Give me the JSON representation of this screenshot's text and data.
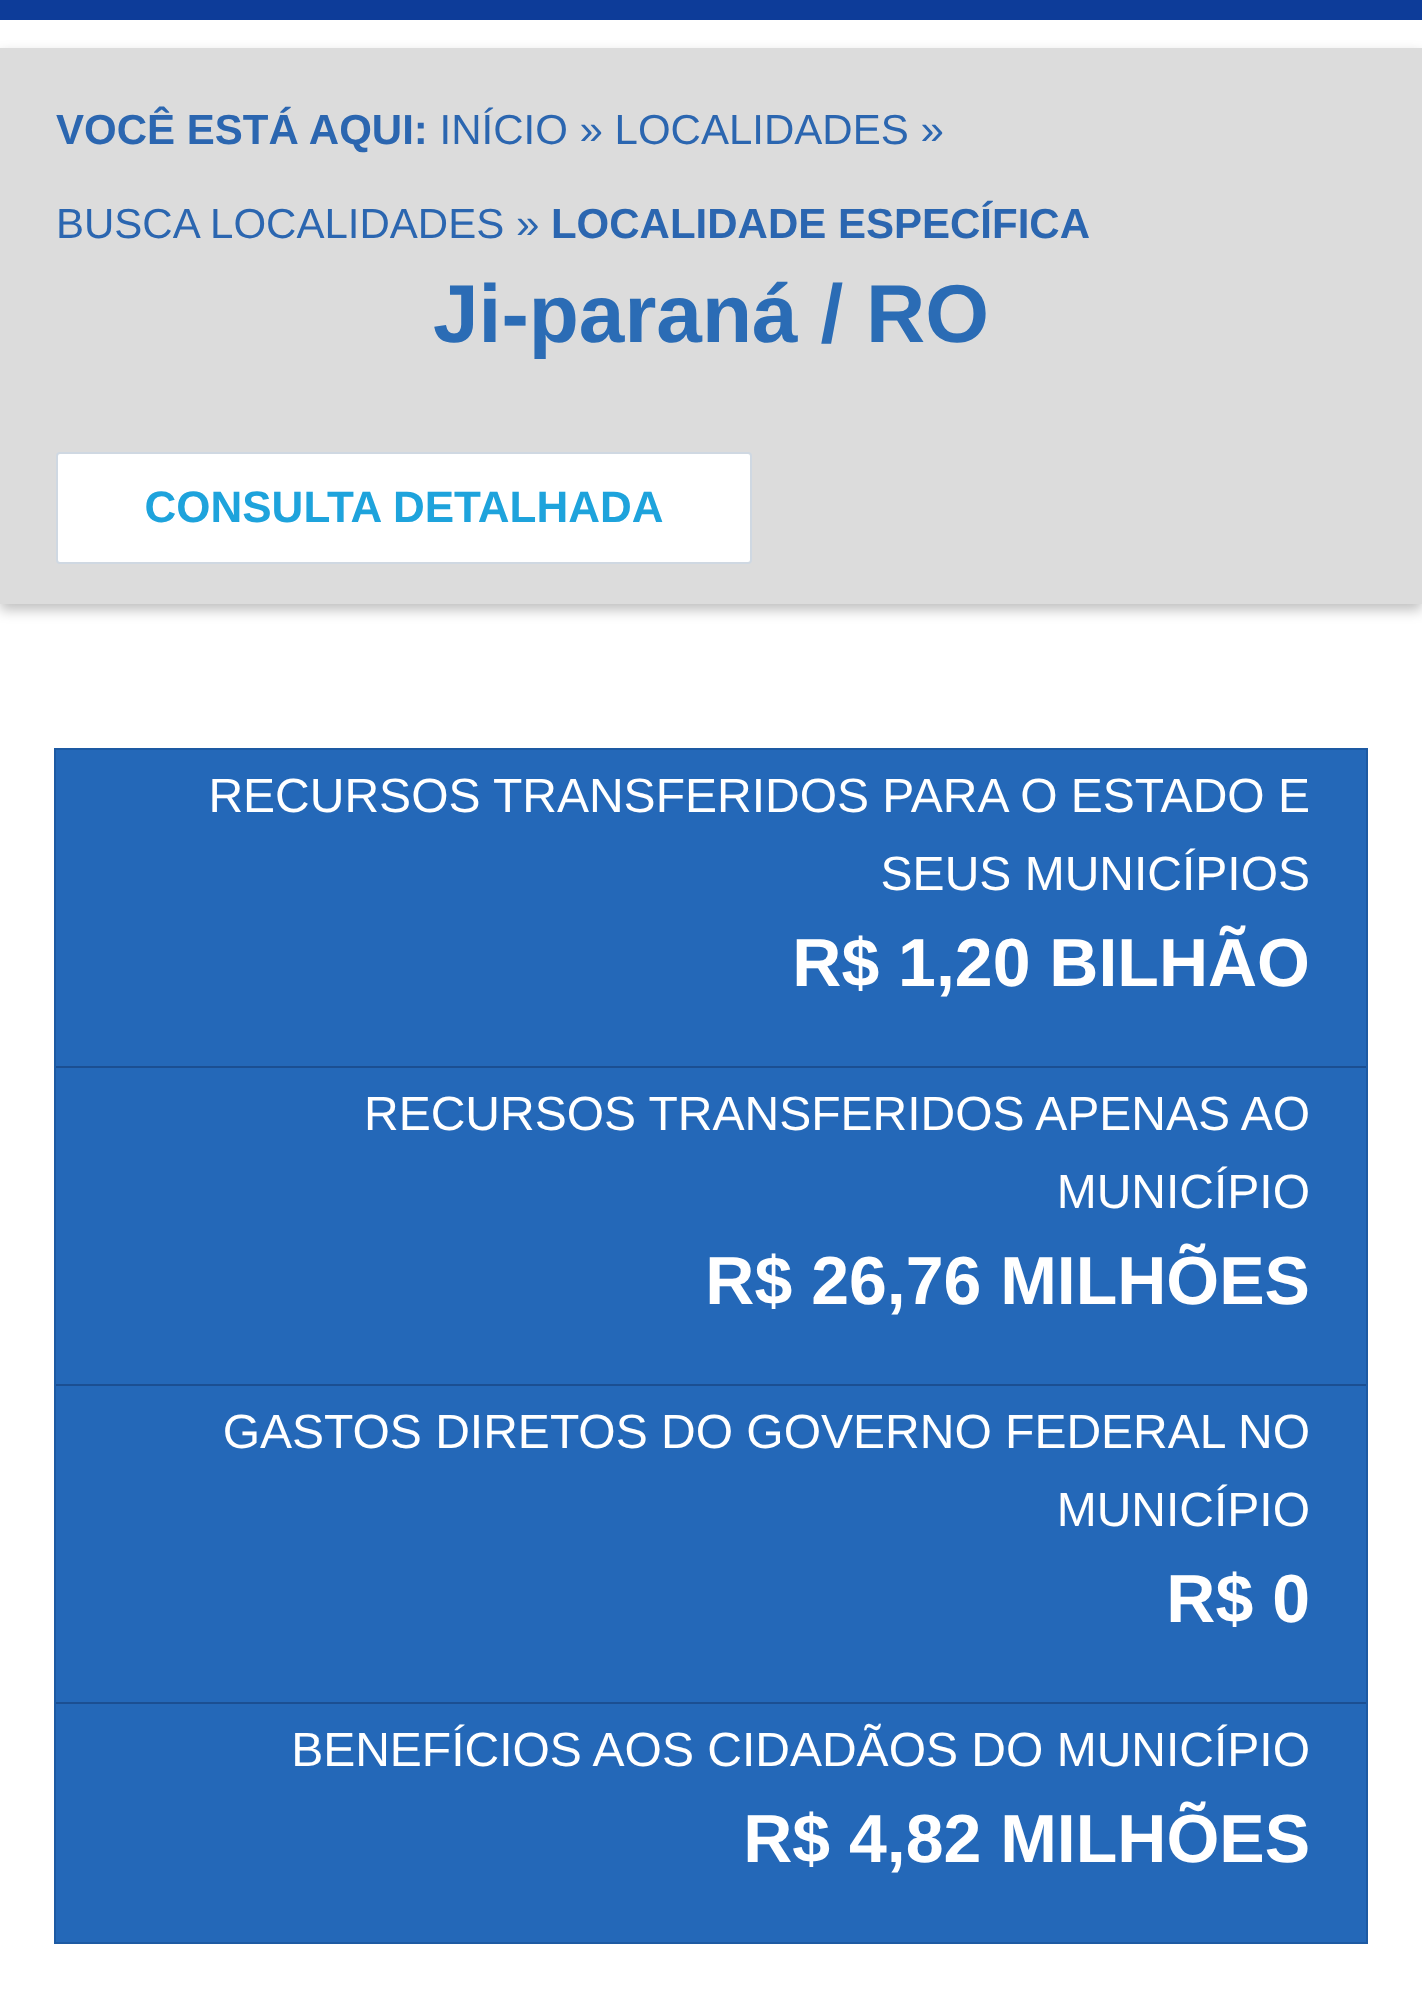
{
  "breadcrumb": [
    {
      "kind": "label",
      "text": "VOCÊ ESTÁ AQUI:"
    },
    {
      "kind": "link",
      "text": "INÍCIO"
    },
    {
      "kind": "separator",
      "text": "»"
    },
    {
      "kind": "link",
      "text": "LOCALIDADES"
    },
    {
      "kind": "separator",
      "text": "»"
    },
    {
      "kind": "link",
      "text": "BUSCA LOCALIDADES"
    },
    {
      "kind": "separator",
      "text": "»"
    },
    {
      "kind": "current",
      "text": "LOCALIDADE ESPECÍFICA"
    }
  ],
  "title": "Ji-paraná / RO",
  "button": "CONSULTA DETALHADA",
  "summary": [
    {
      "label": "RECURSOS TRANSFERIDOS PARA O ESTADO E SEUS MUNICÍPIOS",
      "value": "R$ 1,20 BILHÃO"
    },
    {
      "label": "RECURSOS TRANSFERIDOS APENAS AO MUNICÍPIO",
      "value": "R$ 26,76 MILHÕES"
    },
    {
      "label": "GASTOS DIRETOS DO GOVERNO FEDERAL NO MUNICÍPIO",
      "value": "R$ 0"
    },
    {
      "label": "BENEFÍCIOS AOS CIDADÃOS DO MUNICÍPIO",
      "value": "R$ 4,82 MILHÕES"
    }
  ]
}
